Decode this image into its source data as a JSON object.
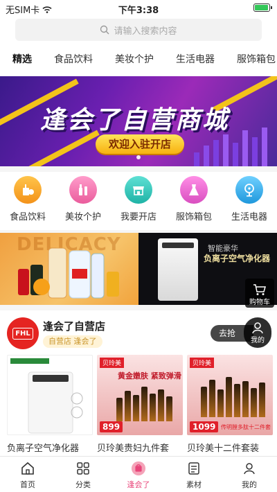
{
  "status": {
    "carrier": "无SIM卡",
    "time": "下午3:38",
    "battery_level": 0.85
  },
  "search": {
    "placeholder": "请输入搜索内容"
  },
  "categories": [
    "精选",
    "食品饮料",
    "美妆个护",
    "生活电器",
    "服饰箱包"
  ],
  "banner": {
    "title": "逢会了自营商城",
    "button": "欢迎入驻开店"
  },
  "quick": [
    {
      "label": "食品饮料",
      "color": "#f39a1c",
      "icon": "food-icon"
    },
    {
      "label": "美妆个护",
      "color": "#f06aa0",
      "icon": "makeup-icon"
    },
    {
      "label": "我要开店",
      "color": "#2cc4b8",
      "icon": "shop-icon"
    },
    {
      "label": "服饰箱包",
      "color": "#e85ac8",
      "icon": "dress-icon"
    },
    {
      "label": "生活电器",
      "color": "#2aa9e8",
      "icon": "fan-icon"
    }
  ],
  "promo": {
    "left_bg_text": "DELICACY",
    "right_brand": "智能豪华",
    "right_name": "负离子空气净化器"
  },
  "store": {
    "logo_text": "FHL",
    "name": "逢会了自营店",
    "tag": "自营店 逢会了"
  },
  "products": [
    {
      "name": "负离子空气净化器"
    },
    {
      "name": "贝玲美贵妇九件套",
      "brand": "贝玲美",
      "price": "899",
      "sub": "黄金嫩肤 紧致弹滑"
    },
    {
      "name": "贝玲美十二件套装",
      "brand": "贝玲美",
      "price": "1099",
      "sub": "传明膛多肽十二件套"
    }
  ],
  "floating": {
    "cart": "购物车",
    "grab": "去抢",
    "me": "我的"
  },
  "tabs": [
    {
      "label": "首页",
      "icon": "home-icon"
    },
    {
      "label": "分类",
      "icon": "grid-icon"
    },
    {
      "label": "逢会了",
      "icon": "fenghuile-icon"
    },
    {
      "label": "素材",
      "icon": "document-icon"
    },
    {
      "label": "我的",
      "icon": "user-icon"
    }
  ],
  "colors": {
    "accent": "#e8457a",
    "banner_yellow": "#f3c31a",
    "brand_red": "#e52421"
  }
}
